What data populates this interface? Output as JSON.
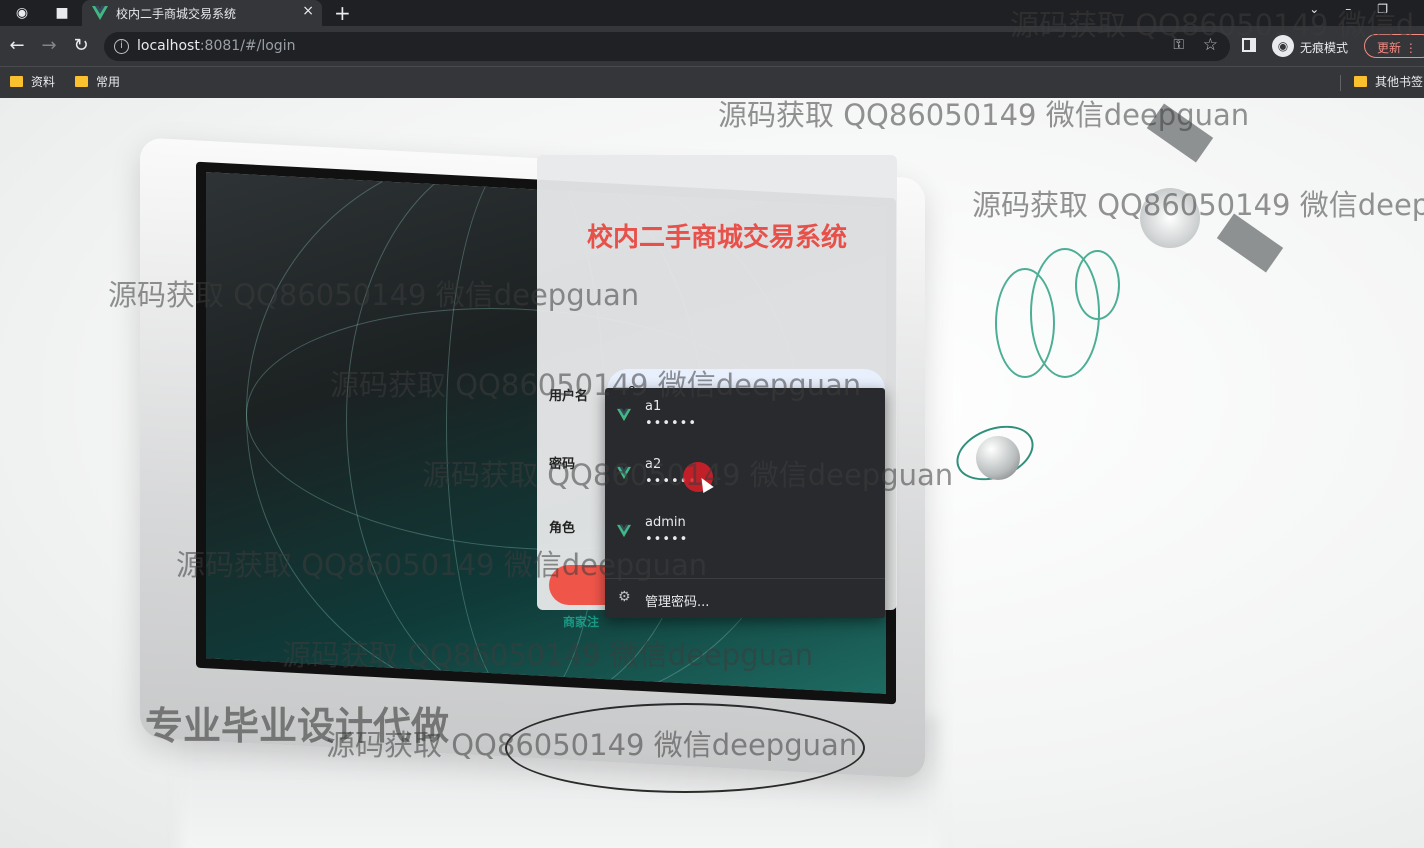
{
  "browser": {
    "tab_title": "校内二手商城交易系统",
    "tab_close": "×",
    "new_tab": "+",
    "url_host": "localhost",
    "url_rest": ":8081/#/login",
    "incognito_label": "无痕模式",
    "update_label": "更新",
    "bookmarks": [
      "资料",
      "常用"
    ],
    "other_bookmarks": "其他书签"
  },
  "login": {
    "title": "校内二手商城交易系统",
    "username_label": "用户名",
    "username_value": "a2",
    "password_label": "密码",
    "password_value": "•••••",
    "role_label": "角色",
    "register_link": "商家注"
  },
  "autofill": {
    "items": [
      {
        "user": "a1",
        "pass": "••••••"
      },
      {
        "user": "a2",
        "pass": "••••••"
      },
      {
        "user": "admin",
        "pass": "•••••"
      }
    ],
    "manage_label": "管理密码..."
  },
  "watermarks": {
    "text": "源码获取 QQ86050149 微信deepguan",
    "text_cut_top": "源码获取 QQ86050149 微信d",
    "text_cut_right": "源码获取 QQ86050149 微信deep",
    "promo": "专业毕业设计代做"
  },
  "colors": {
    "title_red": "#e8504a",
    "button_red": "#f0554a",
    "link_teal": "#1a9a86",
    "vue_green": "#41b883"
  }
}
